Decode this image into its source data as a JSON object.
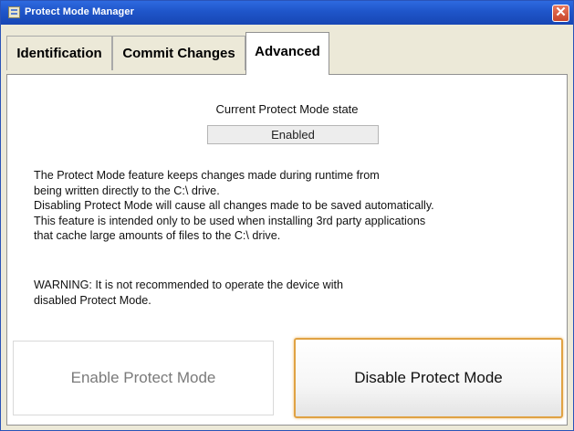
{
  "window": {
    "title": "Protect Mode Manager",
    "close_glyph": "✕"
  },
  "tabs": [
    {
      "label": "Identification",
      "active": false
    },
    {
      "label": "Commit Changes",
      "active": false
    },
    {
      "label": "Advanced",
      "active": true
    }
  ],
  "advanced": {
    "state_label": "Current Protect Mode state",
    "state_value": "Enabled",
    "description": [
      "The Protect Mode feature keeps changes made during runtime from",
      "being written directly to the C:\\ drive.",
      "Disabling Protect Mode will cause all changes made to be saved automatically.",
      "This feature is intended only to be used when installing 3rd party applications",
      "that cache large amounts of files to the C:\\ drive."
    ],
    "warning": [
      "WARNING: It is not recommended to operate the device with",
      "disabled Protect Mode."
    ],
    "enable_button": "Enable Protect Mode",
    "disable_button": "Disable Protect Mode"
  },
  "colors": {
    "titlebar": "#1f55c9",
    "close_button": "#d4553a",
    "focus_border": "#e0a243",
    "disabled_text": "#7a7a7a"
  },
  "icons": {
    "app_icon": "window-app-icon",
    "close": "close-icon"
  }
}
